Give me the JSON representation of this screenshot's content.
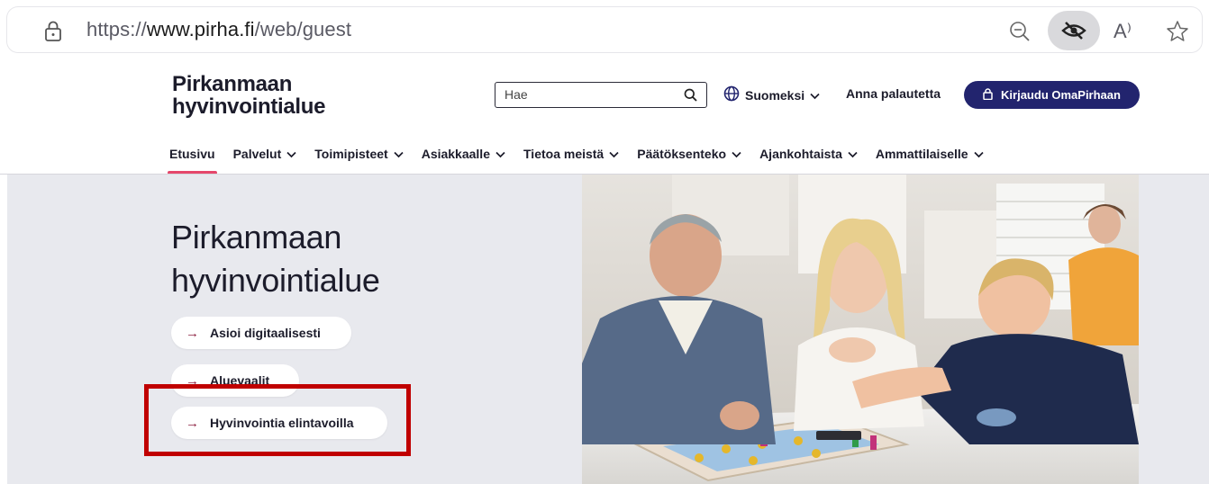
{
  "browser": {
    "url_prefix": "https://",
    "url_host": "www.pirha.fi",
    "url_path": "/web/guest",
    "read_aloud_glyph": "A⁾"
  },
  "header": {
    "logo_line1": "Pirkanmaan",
    "logo_line2": "hyvinvointialue",
    "search_placeholder": "Hae",
    "language": "Suomeksi",
    "feedback": "Anna palautetta",
    "login": "Kirjaudu OmaPirhaan"
  },
  "nav": {
    "items": [
      {
        "label": "Etusivu",
        "has_dropdown": false,
        "active": true
      },
      {
        "label": "Palvelut",
        "has_dropdown": true
      },
      {
        "label": "Toimipisteet",
        "has_dropdown": true
      },
      {
        "label": "Asiakkaalle",
        "has_dropdown": true
      },
      {
        "label": "Tietoa meistä",
        "has_dropdown": true
      },
      {
        "label": "Päätöksenteko",
        "has_dropdown": true
      },
      {
        "label": "Ajankohtaista",
        "has_dropdown": true
      },
      {
        "label": "Ammattilaiselle",
        "has_dropdown": true
      }
    ]
  },
  "hero": {
    "title_line1": "Pirkanmaan",
    "title_line2": "hyvinvointialue",
    "links": [
      {
        "label": "Asioi digitaalisesti"
      },
      {
        "label": "Aluevaalit"
      },
      {
        "label": "Hyvinvointia elintavoilla"
      }
    ],
    "highlight_color": "#c00000"
  },
  "colors": {
    "brand_navy": "#22246e",
    "active_underline": "#e5476b",
    "arrow": "#8b1f3f",
    "hero_bg": "#e8e9ee"
  },
  "icons": {
    "address": "lock-icon",
    "zoom": "zoom-out-icon",
    "tracking": "eye-slash-icon",
    "favorite": "star-icon",
    "search": "search-icon",
    "language": "globe-icon",
    "login": "lock-icon",
    "dropdown": "chevron-down-icon",
    "link": "arrow-right-icon"
  }
}
